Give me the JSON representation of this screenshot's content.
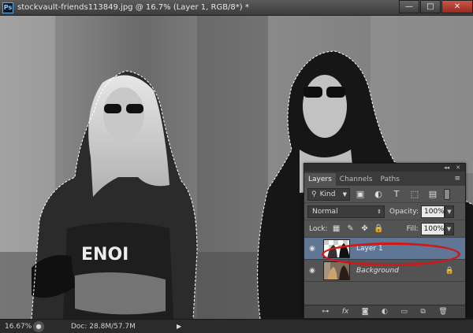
{
  "window": {
    "title": "stockvault-friends113849.jpg @ 16.7% (Layer 1, RGB/8*) *",
    "app_badge": "Ps",
    "buttons": {
      "minimize": "—",
      "maximize": "□",
      "close": "✕"
    }
  },
  "status": {
    "zoom": "16.67%",
    "doc_info": "Doc: 28.8M/57.7M"
  },
  "panel": {
    "tabs": [
      "Layers",
      "Channels",
      "Paths"
    ],
    "active_tab": "Layers",
    "filter_kind": "Kind",
    "blend_mode": "Normal",
    "opacity_label": "Opacity:",
    "opacity_value": "100%",
    "lock_label": "Lock:",
    "fill_label": "Fill:",
    "fill_value": "100%",
    "layers": [
      {
        "name": "Layer 1",
        "selected": true,
        "visible": true,
        "locked": false
      },
      {
        "name": "Background",
        "selected": false,
        "visible": true,
        "locked": true
      }
    ]
  },
  "colors": {
    "selected_layer": "#5f7794",
    "highlight_oval": "#d01818",
    "panel_bg": "#535353"
  },
  "icons": {
    "filter": [
      "image-filter-icon",
      "adjustment-filter-icon",
      "type-filter-icon",
      "shape-filter-icon",
      "smart-object-filter-icon"
    ],
    "lock": [
      "lock-transparent-icon",
      "lock-image-icon",
      "lock-position-icon",
      "lock-all-icon"
    ],
    "bottom": [
      "link-layers-icon",
      "fx-icon",
      "add-mask-icon",
      "new-adjustment-icon",
      "new-group-icon",
      "new-layer-icon",
      "delete-layer-icon"
    ]
  }
}
